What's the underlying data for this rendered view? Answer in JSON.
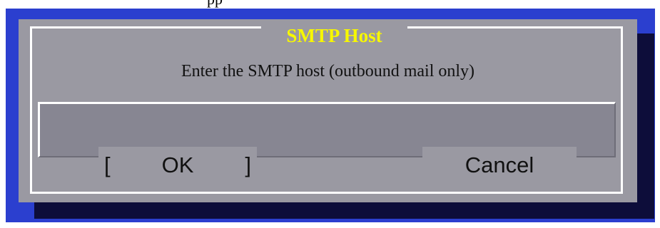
{
  "top_fragment": "pp",
  "dialog": {
    "title": "SMTP Host",
    "prompt": "Enter the SMTP host (outbound mail only)",
    "input_value": "",
    "ok": {
      "bracket_left": "[",
      "label": "OK",
      "bracket_right": "]"
    },
    "cancel_label": "Cancel"
  },
  "colors": {
    "screen_background": "#2b3fcf",
    "dialog_background": "#9a99a2",
    "shadow": "#0d0d3a",
    "title": "#f7f700",
    "frame": "#ffffff",
    "input_background": "#878692"
  }
}
